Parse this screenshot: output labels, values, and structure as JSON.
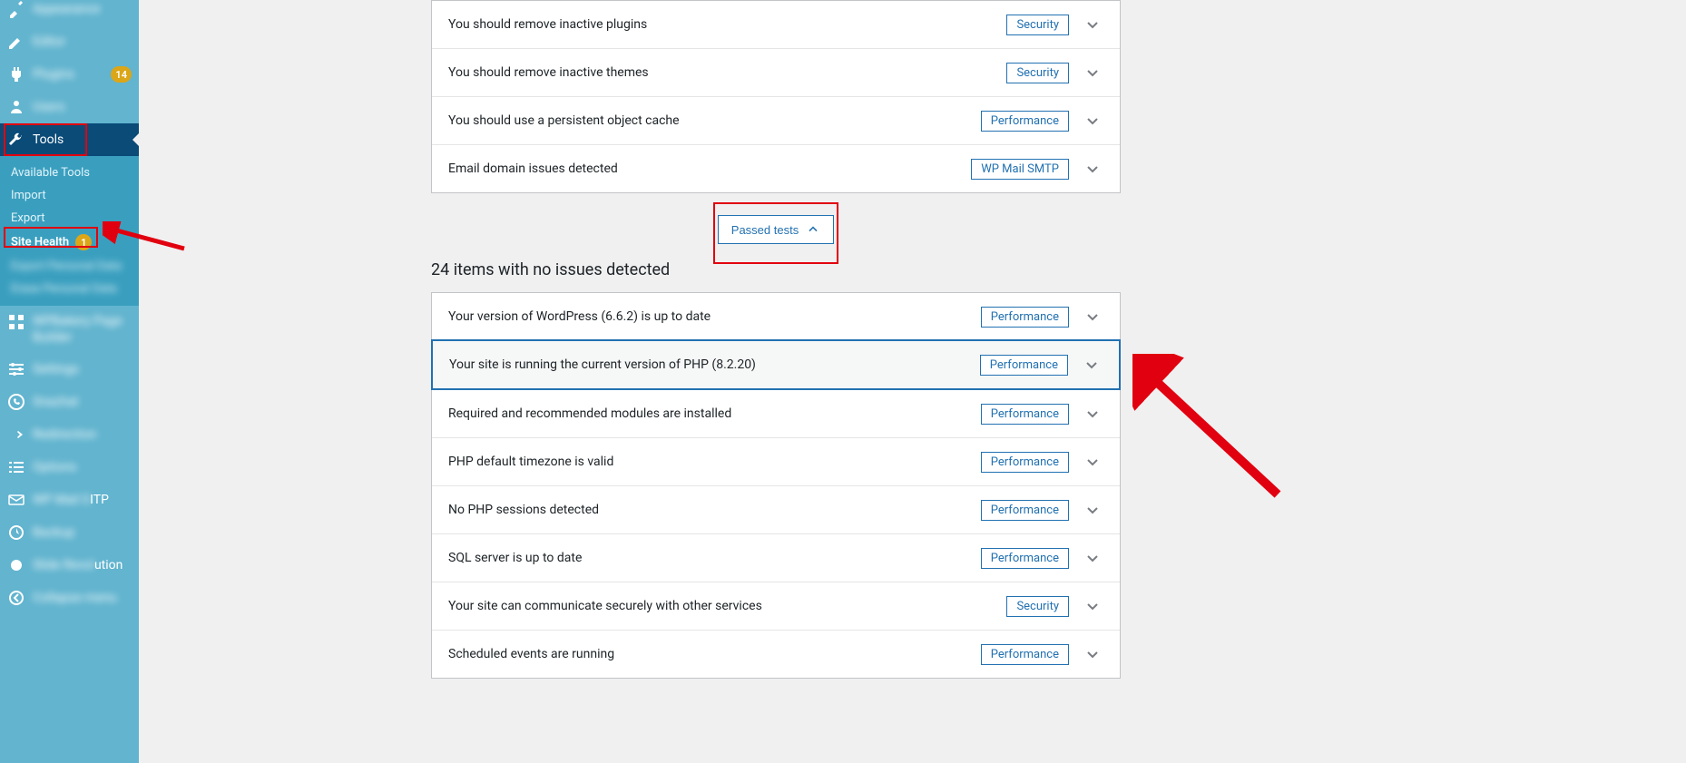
{
  "sidebar": {
    "items": [
      {
        "label": "Appearance",
        "icon": "brush-icon",
        "blurred": true
      },
      {
        "label": "Editor",
        "icon": "pencil-icon",
        "blurred": true
      },
      {
        "label": "Plugins",
        "icon": "plugin-icon",
        "blurred": true,
        "badge": "14",
        "badge_color": "orange"
      },
      {
        "label": "Users",
        "icon": "user-icon",
        "blurred": true
      },
      {
        "label": "Tools",
        "icon": "wrench-icon",
        "current": true
      }
    ],
    "lower": [
      {
        "label": "WPBakery Page Builder",
        "icon": "grid-icon",
        "blurred": true,
        "multiline": true
      },
      {
        "label": "Settings",
        "icon": "sliders-icon",
        "blurred": true
      },
      {
        "label": "Snazhat",
        "icon": "whatsapp-icon",
        "blurred": true
      },
      {
        "label": "Redirection",
        "icon": "redirect-icon",
        "blurred": true
      },
      {
        "label": "Options",
        "icon": "list-icon",
        "blurred": true
      },
      {
        "label": "WP Mail SMTP",
        "icon": "mail-icon",
        "partial_blur": "WP Mail S",
        "visible_suffix": "ITP"
      },
      {
        "label": "Backup",
        "icon": "backup-icon",
        "blurred": true
      },
      {
        "label": "Slide Revolution",
        "icon": "circle-icon",
        "partial_visible": "ution"
      },
      {
        "label": "Collapse menu",
        "icon": "collapse-icon",
        "blurred": true
      }
    ],
    "submenu": [
      {
        "label": "Available Tools"
      },
      {
        "label": "Import"
      },
      {
        "label": "Export"
      },
      {
        "label": "Site Health",
        "current": true,
        "badge": "1"
      },
      {
        "label": "Export Personal Data",
        "blurred": true
      },
      {
        "label": "Erase Personal Data",
        "blurred": true
      }
    ]
  },
  "issues": [
    {
      "text": "You should remove inactive plugins",
      "tag": "Security"
    },
    {
      "text": "You should remove inactive themes",
      "tag": "Security"
    },
    {
      "text": "You should use a persistent object cache",
      "tag": "Performance"
    },
    {
      "text": "Email domain issues detected",
      "tag": "WP Mail SMTP"
    }
  ],
  "passed_button": "Passed tests",
  "passed_title": "24 items with no issues detected",
  "passed": [
    {
      "text": "Your version of WordPress (6.6.2) is up to date",
      "tag": "Performance"
    },
    {
      "text": "Your site is running the current version of PHP (8.2.20)",
      "tag": "Performance",
      "highlight": true
    },
    {
      "text": "Required and recommended modules are installed",
      "tag": "Performance"
    },
    {
      "text": "PHP default timezone is valid",
      "tag": "Performance"
    },
    {
      "text": "No PHP sessions detected",
      "tag": "Performance"
    },
    {
      "text": "SQL server is up to date",
      "tag": "Performance"
    },
    {
      "text": "Your site can communicate securely with other services",
      "tag": "Security"
    },
    {
      "text": "Scheduled events are running",
      "tag": "Performance"
    }
  ],
  "annotations": {
    "highlight_tools": true,
    "highlight_site_health": true
  }
}
